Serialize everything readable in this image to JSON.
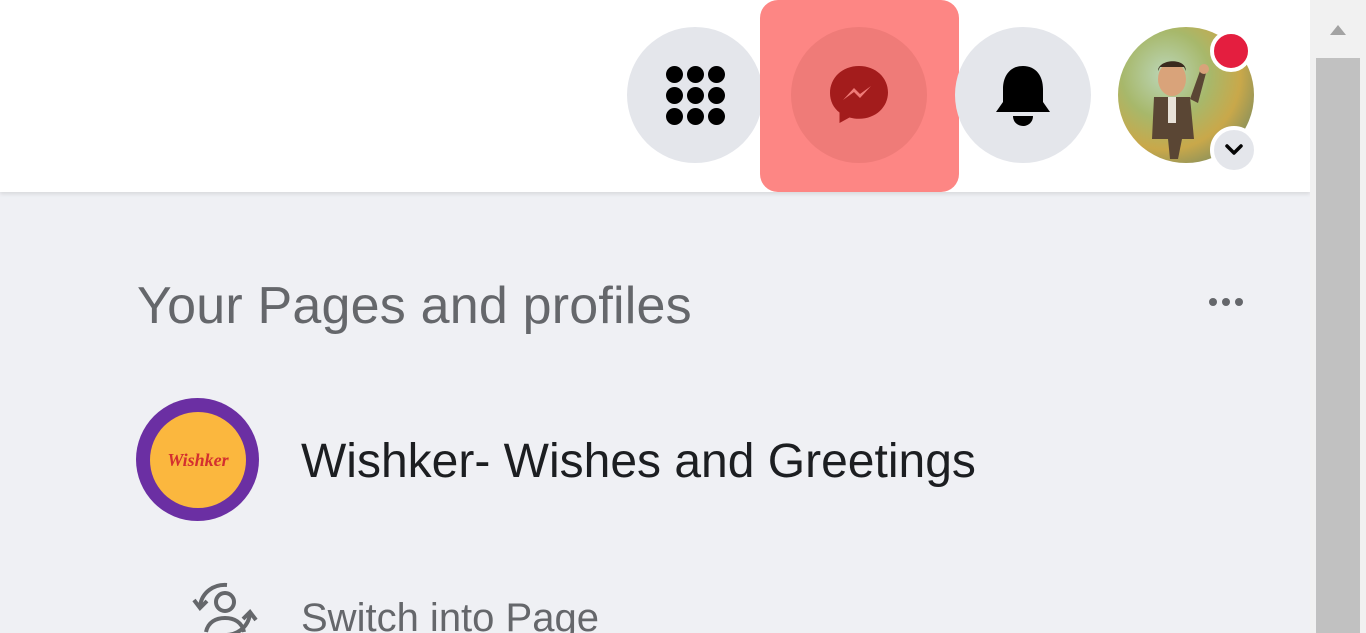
{
  "header": {
    "menu_icon": "grid-menu-icon",
    "messenger_icon": "messenger-icon",
    "notifications_icon": "bell-icon",
    "account_icon": "chevron-down-icon",
    "highlight_color": "#fd8684",
    "notification_dot_color": "#e41e3f"
  },
  "pages_section": {
    "title": "Your Pages and profiles",
    "more_icon": "more-dots-icon",
    "pages": [
      {
        "name": "Wishker- Wishes and Greetings",
        "logo_text": "Wishker"
      }
    ],
    "switch_label": "Switch into Page",
    "switch_icon": "switch-profile-icon"
  },
  "scrollbar": {
    "up_icon": "scroll-up-arrow-icon"
  }
}
